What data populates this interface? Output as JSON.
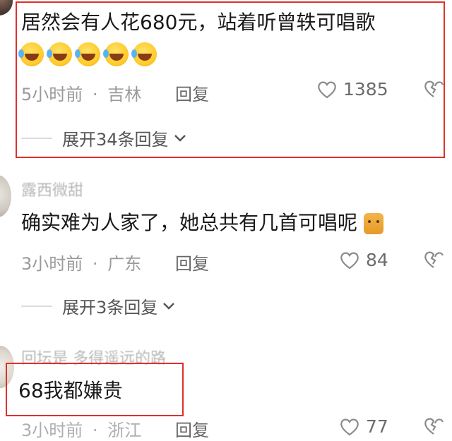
{
  "comments": [
    {
      "text": "居然会有人花680元，站着听曾轶可唱歌",
      "emoji_count": 5,
      "time": "5小时前",
      "location": "吉林",
      "reply_label": "回复",
      "likes": "1385",
      "expand_label": "展开34条回复"
    },
    {
      "username": "露西微甜",
      "text": "确实难为人家了，她总共有几首可唱呢",
      "time": "3小时前",
      "location": "广东",
      "reply_label": "回复",
      "likes": "84",
      "expand_label": "展开3条回复"
    },
    {
      "username": "回坛是 多得遥远的路",
      "text": "68我都嫌贵",
      "time": "3小时前",
      "location": "浙江",
      "reply_label": "回复",
      "likes": "77"
    }
  ],
  "meta_separator": "·",
  "icons": {
    "like": "heart-outline-icon",
    "dislike": "broken-heart-icon",
    "expand": "chevron-down-icon",
    "emoji": "rofl-emoji-icon",
    "cat": "cat-emoji-icon"
  },
  "colors": {
    "highlight_box": "#e0302b",
    "meta_text": "#9a9a9a",
    "body_text": "#1a1a1a"
  }
}
